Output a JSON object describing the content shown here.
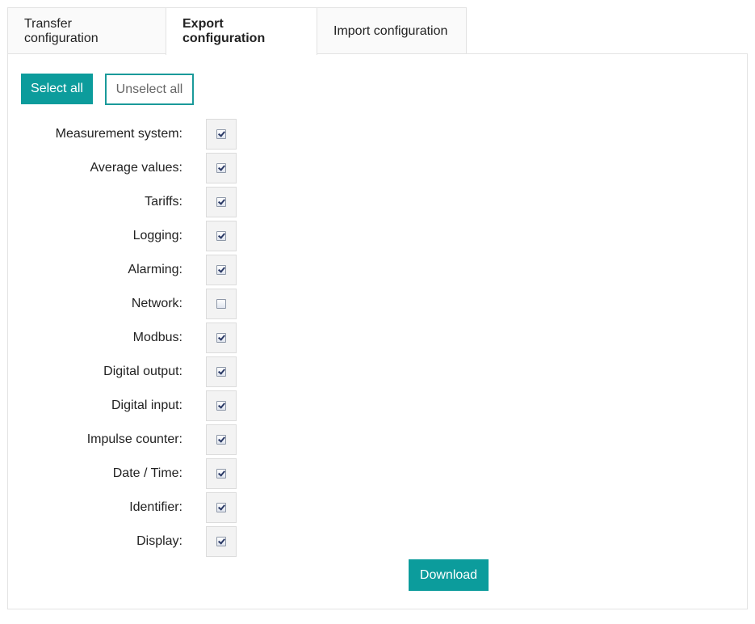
{
  "tabs": [
    {
      "label": "Transfer configuration",
      "active": false
    },
    {
      "label": "Export configuration",
      "active": true
    },
    {
      "label": "Import configuration",
      "active": false
    }
  ],
  "toolbar": {
    "select_all_label": "Select all",
    "unselect_all_label": "Unselect all"
  },
  "options": [
    {
      "label": "Measurement system:",
      "checked": true
    },
    {
      "label": "Average values:",
      "checked": true
    },
    {
      "label": "Tariffs:",
      "checked": true
    },
    {
      "label": "Logging:",
      "checked": true
    },
    {
      "label": "Alarming:",
      "checked": true
    },
    {
      "label": "Network:",
      "checked": false
    },
    {
      "label": "Modbus:",
      "checked": true
    },
    {
      "label": "Digital output:",
      "checked": true
    },
    {
      "label": "Digital input:",
      "checked": true
    },
    {
      "label": "Impulse counter:",
      "checked": true
    },
    {
      "label": "Date / Time:",
      "checked": true
    },
    {
      "label": "Identifier:",
      "checked": true
    },
    {
      "label": "Display:",
      "checked": true
    }
  ],
  "actions": {
    "download_label": "Download"
  },
  "colors": {
    "accent": "#0c9c9c",
    "border": "#e3e3e3"
  }
}
